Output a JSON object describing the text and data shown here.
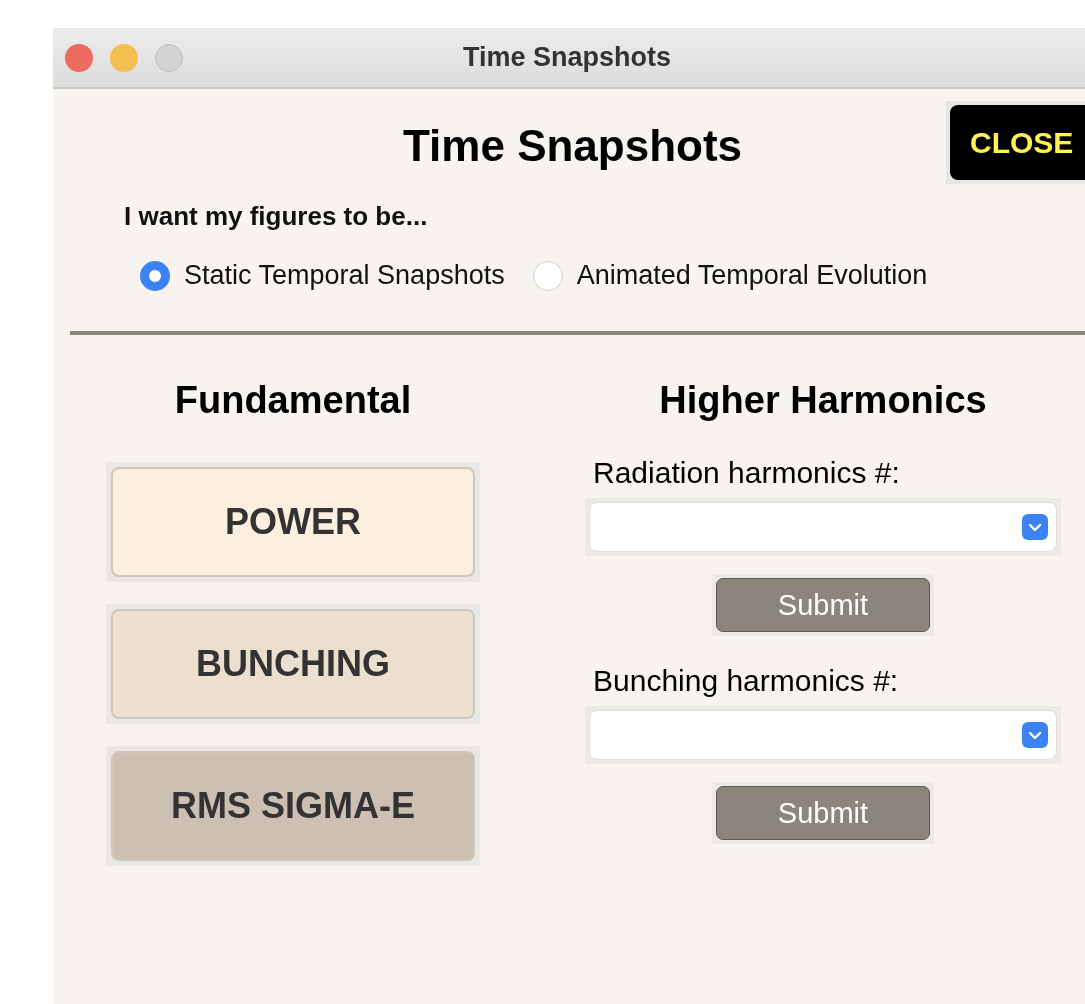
{
  "window": {
    "title": "Time Snapshots"
  },
  "heading": "Time Snapshots",
  "close_button": "CLOSE",
  "mode": {
    "prompt": "I want my figures to be...",
    "options": [
      {
        "label": "Static Temporal Snapshots",
        "selected": true
      },
      {
        "label": "Animated Temporal Evolution",
        "selected": false
      }
    ]
  },
  "fundamental": {
    "title": "Fundamental",
    "buttons": [
      {
        "label": "POWER",
        "color": "#fcefe0"
      },
      {
        "label": "BUNCHING",
        "color": "#ebe0cf"
      },
      {
        "label": "RMS SIGMA-E",
        "color": "#cbc0b2"
      }
    ]
  },
  "higher_harmonics": {
    "title": "Higher Harmonics",
    "groups": [
      {
        "label": "Radiation harmonics #:",
        "submit": "Submit"
      },
      {
        "label": "Bunching harmonics #:",
        "submit": "Submit"
      }
    ]
  }
}
